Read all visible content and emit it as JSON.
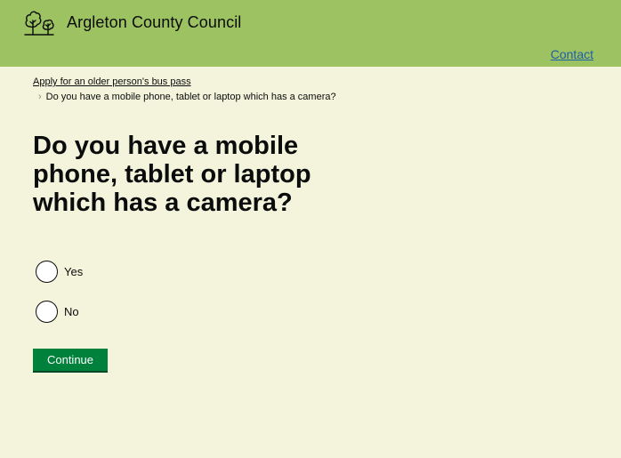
{
  "header": {
    "logo_text": "Argleton County Council",
    "logo_icon": "trees-icon",
    "contact_label": "Contact",
    "background_color": "#9dc262"
  },
  "breadcrumb": {
    "parent_label": "Apply for an older person's bus pass",
    "current_label": "Do you have a mobile phone, tablet or laptop which has a camera?",
    "separator_icon": "chevron-right-icon"
  },
  "question": {
    "title": "Do you have a mobile phone, tablet or laptop which has a camera?",
    "options": [
      {
        "label": "Yes",
        "selected": false
      },
      {
        "label": "No",
        "selected": false
      }
    ]
  },
  "form": {
    "continue_label": "Continue",
    "button_color": "#00813b"
  },
  "page": {
    "background_color": "#f4f4dc"
  }
}
